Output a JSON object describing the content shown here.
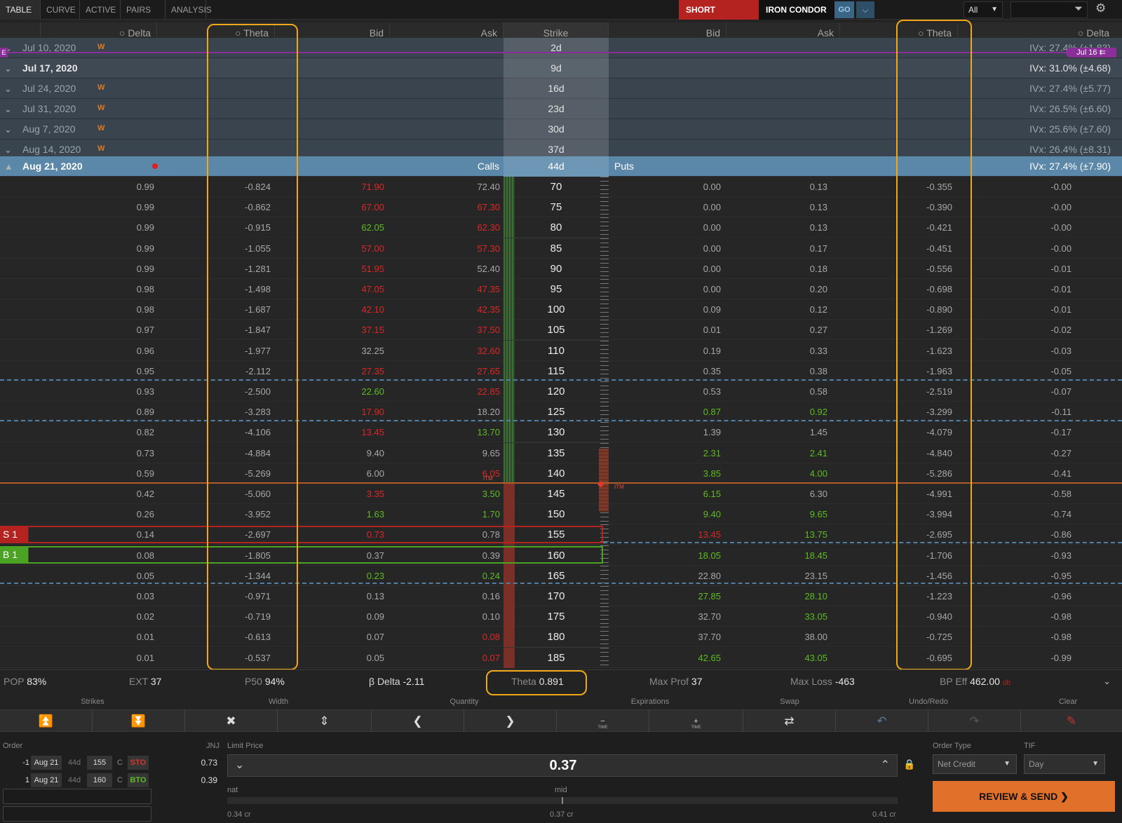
{
  "tabs": [
    "TABLE",
    "CURVE",
    "ACTIVE",
    "PAIRS",
    "ANALYSIS"
  ],
  "strategy": {
    "side": "SHORT",
    "name": "IRON CONDOR",
    "go_label": "GO",
    "filter_value": "All"
  },
  "headers": {
    "c_delta": "Delta",
    "c_theta": "Theta",
    "c_bid": "Bid",
    "c_ask": "Ask",
    "strike": "Strike",
    "p_bid": "Bid",
    "p_ask": "Ask",
    "p_theta": "Theta",
    "p_delta": "Delta"
  },
  "expirations": [
    {
      "date": "Jul 10, 2020",
      "weekly": "W",
      "dte": "2d",
      "ivx": "IVx: 27.4% (±1.83)"
    },
    {
      "date": "Jul 17, 2020",
      "weekly": "",
      "dte": "9d",
      "ivx": "IVx: 31.0% (±4.68)"
    },
    {
      "date": "Jul 24, 2020",
      "weekly": "W",
      "dte": "16d",
      "ivx": "IVx: 27.4% (±5.77)"
    },
    {
      "date": "Jul 31, 2020",
      "weekly": "W",
      "dte": "23d",
      "ivx": "IVx: 26.5% (±6.60)"
    },
    {
      "date": "Aug 7, 2020",
      "weekly": "W",
      "dte": "30d",
      "ivx": "IVx: 25.6% (±7.60)"
    },
    {
      "date": "Aug 14, 2020",
      "weekly": "W",
      "dte": "37d",
      "ivx": "IVx: 26.4% (±8.31)"
    }
  ],
  "open_expiration": {
    "date": "Aug 21, 2020",
    "dte": "44d",
    "ivx": "IVx: 27.4% (±7.90)",
    "calls_label": "Calls",
    "puts_label": "Puts"
  },
  "earnings_marker": "E",
  "today_marker": "Jul 16",
  "itm_label": "ITM",
  "legs": {
    "short": "S 1",
    "long": "B 1"
  },
  "chain": [
    {
      "strike": "70",
      "c_delta": "0.99",
      "c_theta": "-0.824",
      "c_bid": "71.90",
      "c_bid_dir": "up",
      "c_ask": "72.40",
      "c_ask_dir": "nt",
      "p_bid": "0.00",
      "p_bid_dir": "nt",
      "p_ask": "0.13",
      "p_ask_dir": "nt",
      "p_theta": "-0.355",
      "p_delta": "-0.00"
    },
    {
      "strike": "75",
      "c_delta": "0.99",
      "c_theta": "-0.862",
      "c_bid": "67.00",
      "c_bid_dir": "up",
      "c_ask": "67.30",
      "c_ask_dir": "up",
      "p_bid": "0.00",
      "p_bid_dir": "nt",
      "p_ask": "0.13",
      "p_ask_dir": "nt",
      "p_theta": "-0.390",
      "p_delta": "-0.00"
    },
    {
      "strike": "80",
      "c_delta": "0.99",
      "c_theta": "-0.915",
      "c_bid": "62.05",
      "c_bid_dir": "dn",
      "c_ask": "62.30",
      "c_ask_dir": "up",
      "p_bid": "0.00",
      "p_bid_dir": "nt",
      "p_ask": "0.13",
      "p_ask_dir": "nt",
      "p_theta": "-0.421",
      "p_delta": "-0.00"
    },
    {
      "strike": "85",
      "c_delta": "0.99",
      "c_theta": "-1.055",
      "c_bid": "57.00",
      "c_bid_dir": "up",
      "c_ask": "57.30",
      "c_ask_dir": "up",
      "p_bid": "0.00",
      "p_bid_dir": "nt",
      "p_ask": "0.17",
      "p_ask_dir": "nt",
      "p_theta": "-0.451",
      "p_delta": "-0.00"
    },
    {
      "strike": "90",
      "c_delta": "0.99",
      "c_theta": "-1.281",
      "c_bid": "51.95",
      "c_bid_dir": "up",
      "c_ask": "52.40",
      "c_ask_dir": "nt",
      "p_bid": "0.00",
      "p_bid_dir": "nt",
      "p_ask": "0.18",
      "p_ask_dir": "nt",
      "p_theta": "-0.556",
      "p_delta": "-0.01"
    },
    {
      "strike": "95",
      "c_delta": "0.98",
      "c_theta": "-1.498",
      "c_bid": "47.05",
      "c_bid_dir": "up",
      "c_ask": "47.35",
      "c_ask_dir": "up",
      "p_bid": "0.00",
      "p_bid_dir": "nt",
      "p_ask": "0.20",
      "p_ask_dir": "nt",
      "p_theta": "-0.698",
      "p_delta": "-0.01"
    },
    {
      "strike": "100",
      "c_delta": "0.98",
      "c_theta": "-1.687",
      "c_bid": "42.10",
      "c_bid_dir": "up",
      "c_ask": "42.35",
      "c_ask_dir": "up",
      "p_bid": "0.09",
      "p_bid_dir": "nt",
      "p_ask": "0.12",
      "p_ask_dir": "nt",
      "p_theta": "-0.890",
      "p_delta": "-0.01"
    },
    {
      "strike": "105",
      "c_delta": "0.97",
      "c_theta": "-1.847",
      "c_bid": "37.15",
      "c_bid_dir": "up",
      "c_ask": "37.50",
      "c_ask_dir": "up",
      "p_bid": "0.01",
      "p_bid_dir": "nt",
      "p_ask": "0.27",
      "p_ask_dir": "nt",
      "p_theta": "-1.269",
      "p_delta": "-0.02"
    },
    {
      "strike": "110",
      "c_delta": "0.96",
      "c_theta": "-1.977",
      "c_bid": "32.25",
      "c_bid_dir": "nt",
      "c_ask": "32.60",
      "c_ask_dir": "up",
      "p_bid": "0.19",
      "p_bid_dir": "nt",
      "p_ask": "0.33",
      "p_ask_dir": "nt",
      "p_theta": "-1.623",
      "p_delta": "-0.03"
    },
    {
      "strike": "115",
      "c_delta": "0.95",
      "c_theta": "-2.112",
      "c_bid": "27.35",
      "c_bid_dir": "up",
      "c_ask": "27.65",
      "c_ask_dir": "up",
      "p_bid": "0.35",
      "p_bid_dir": "nt",
      "p_ask": "0.38",
      "p_ask_dir": "nt",
      "p_theta": "-1.963",
      "p_delta": "-0.05"
    },
    {
      "strike": "120",
      "c_delta": "0.93",
      "c_theta": "-2.500",
      "c_bid": "22.60",
      "c_bid_dir": "dn",
      "c_ask": "22.85",
      "c_ask_dir": "up",
      "p_bid": "0.53",
      "p_bid_dir": "nt",
      "p_ask": "0.58",
      "p_ask_dir": "nt",
      "p_theta": "-2.519",
      "p_delta": "-0.07"
    },
    {
      "strike": "125",
      "c_delta": "0.89",
      "c_theta": "-3.283",
      "c_bid": "17.90",
      "c_bid_dir": "up",
      "c_ask": "18.20",
      "c_ask_dir": "nt",
      "p_bid": "0.87",
      "p_bid_dir": "dn",
      "p_ask": "0.92",
      "p_ask_dir": "dn",
      "p_theta": "-3.299",
      "p_delta": "-0.11"
    },
    {
      "strike": "130",
      "c_delta": "0.82",
      "c_theta": "-4.106",
      "c_bid": "13.45",
      "c_bid_dir": "up",
      "c_ask": "13.70",
      "c_ask_dir": "dn",
      "p_bid": "1.39",
      "p_bid_dir": "nt",
      "p_ask": "1.45",
      "p_ask_dir": "nt",
      "p_theta": "-4.079",
      "p_delta": "-0.17"
    },
    {
      "strike": "135",
      "c_delta": "0.73",
      "c_theta": "-4.884",
      "c_bid": "9.40",
      "c_bid_dir": "nt",
      "c_ask": "9.65",
      "c_ask_dir": "nt",
      "p_bid": "2.31",
      "p_bid_dir": "dn",
      "p_ask": "2.41",
      "p_ask_dir": "dn",
      "p_theta": "-4.840",
      "p_delta": "-0.27"
    },
    {
      "strike": "140",
      "c_delta": "0.59",
      "c_theta": "-5.269",
      "c_bid": "6.00",
      "c_bid_dir": "nt",
      "c_ask": "6.05",
      "c_ask_dir": "up",
      "p_bid": "3.85",
      "p_bid_dir": "dn",
      "p_ask": "4.00",
      "p_ask_dir": "dn",
      "p_theta": "-5.286",
      "p_delta": "-0.41"
    },
    {
      "strike": "145",
      "c_delta": "0.42",
      "c_theta": "-5.060",
      "c_bid": "3.35",
      "c_bid_dir": "up",
      "c_ask": "3.50",
      "c_ask_dir": "dn",
      "p_bid": "6.15",
      "p_bid_dir": "dn",
      "p_ask": "6.30",
      "p_ask_dir": "nt",
      "p_theta": "-4.991",
      "p_delta": "-0.58"
    },
    {
      "strike": "150",
      "c_delta": "0.26",
      "c_theta": "-3.952",
      "c_bid": "1.63",
      "c_bid_dir": "dn",
      "c_ask": "1.70",
      "c_ask_dir": "dn",
      "p_bid": "9.40",
      "p_bid_dir": "dn",
      "p_ask": "9.65",
      "p_ask_dir": "dn",
      "p_theta": "-3.994",
      "p_delta": "-0.74"
    },
    {
      "strike": "155",
      "c_delta": "0.14",
      "c_theta": "-2.697",
      "c_bid": "0.73",
      "c_bid_dir": "up",
      "c_ask": "0.78",
      "c_ask_dir": "nt",
      "p_bid": "13.45",
      "p_bid_dir": "up",
      "p_ask": "13.75",
      "p_ask_dir": "dn",
      "p_theta": "-2.695",
      "p_delta": "-0.86"
    },
    {
      "strike": "160",
      "c_delta": "0.08",
      "c_theta": "-1.805",
      "c_bid": "0.37",
      "c_bid_dir": "nt",
      "c_ask": "0.39",
      "c_ask_dir": "nt",
      "p_bid": "18.05",
      "p_bid_dir": "dn",
      "p_ask": "18.45",
      "p_ask_dir": "dn",
      "p_theta": "-1.706",
      "p_delta": "-0.93"
    },
    {
      "strike": "165",
      "c_delta": "0.05",
      "c_theta": "-1.344",
      "c_bid": "0.23",
      "c_bid_dir": "dn",
      "c_ask": "0.24",
      "c_ask_dir": "dn",
      "p_bid": "22.80",
      "p_bid_dir": "nt",
      "p_ask": "23.15",
      "p_ask_dir": "nt",
      "p_theta": "-1.456",
      "p_delta": "-0.95"
    },
    {
      "strike": "170",
      "c_delta": "0.03",
      "c_theta": "-0.971",
      "c_bid": "0.13",
      "c_bid_dir": "nt",
      "c_ask": "0.16",
      "c_ask_dir": "nt",
      "p_bid": "27.85",
      "p_bid_dir": "dn",
      "p_ask": "28.10",
      "p_ask_dir": "dn",
      "p_theta": "-1.223",
      "p_delta": "-0.96"
    },
    {
      "strike": "175",
      "c_delta": "0.02",
      "c_theta": "-0.719",
      "c_bid": "0.09",
      "c_bid_dir": "nt",
      "c_ask": "0.10",
      "c_ask_dir": "nt",
      "p_bid": "32.70",
      "p_bid_dir": "nt",
      "p_ask": "33.05",
      "p_ask_dir": "dn",
      "p_theta": "-0.940",
      "p_delta": "-0.98"
    },
    {
      "strike": "180",
      "c_delta": "0.01",
      "c_theta": "-0.613",
      "c_bid": "0.07",
      "c_bid_dir": "nt",
      "c_ask": "0.08",
      "c_ask_dir": "up",
      "p_bid": "37.70",
      "p_bid_dir": "nt",
      "p_ask": "38.00",
      "p_ask_dir": "nt",
      "p_theta": "-0.725",
      "p_delta": "-0.98"
    },
    {
      "strike": "185",
      "c_delta": "0.01",
      "c_theta": "-0.537",
      "c_bid": "0.05",
      "c_bid_dir": "nt",
      "c_ask": "0.07",
      "c_ask_dir": "up",
      "p_bid": "42.65",
      "p_bid_dir": "dn",
      "p_ask": "43.05",
      "p_ask_dir": "dn",
      "p_theta": "-0.695",
      "p_delta": "-0.99"
    }
  ],
  "stats": {
    "pop_label": "POP",
    "pop": "83%",
    "ext_label": "EXT",
    "ext": "37",
    "p50_label": "P50",
    "p50": "94%",
    "beta_label": "β Delta",
    "beta": "-2.11",
    "theta_label": "Theta",
    "theta": "0.891",
    "maxprof_label": "Max Prof",
    "maxprof": "37",
    "maxloss_label": "Max Loss",
    "maxloss": "-463",
    "bpeff_label": "BP Eff",
    "bpeff": "462.00",
    "bpeff_unit": "db"
  },
  "controls": {
    "strikes": "Strikes",
    "width": "Width",
    "quantity": "Quantity",
    "expirations": "Expirations",
    "swap": "Swap",
    "undo_redo": "Undo/Redo",
    "clear": "Clear",
    "time": "TIME"
  },
  "order": {
    "label": "Order",
    "symbol": "JNJ",
    "legs": [
      {
        "qty": "-1",
        "exp": "Aug 21",
        "dte": "44d",
        "strike": "155",
        "type": "C",
        "action": "STO",
        "price": "0.73"
      },
      {
        "qty": "1",
        "exp": "Aug 21",
        "dte": "44d",
        "strike": "160",
        "type": "C",
        "action": "BTO",
        "price": "0.39"
      }
    ],
    "limit_label": "Limit Price",
    "limit_value": "0.37",
    "nat_label": "nat",
    "mid_label": "mid",
    "nat_value": "0.34 cr",
    "mid_value": "0.37 cr",
    "far_value": "0.41 cr",
    "order_type_label": "Order Type",
    "order_type": "Net Credit",
    "tif_label": "TIF",
    "tif": "Day",
    "review_label": "REVIEW & SEND"
  },
  "colors": {
    "up": "#e02525",
    "down": "#5bbd1f",
    "highlight": "#f0a818",
    "accent": "#e0702a",
    "short": "#b4231f",
    "long": "#4aa322"
  }
}
